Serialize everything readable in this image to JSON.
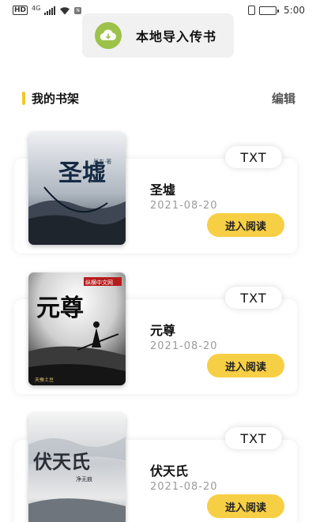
{
  "status_bar": {
    "hd": "HD",
    "network": "4G",
    "badge": "N",
    "time": "5:00",
    "battery_level": 0.85
  },
  "import": {
    "label": "本地导入传书",
    "icon": "cloud-download-icon",
    "icon_color": "#9cc24a"
  },
  "section": {
    "title": "我的书架",
    "edit_label": "编辑",
    "accent_color": "#f2c62b"
  },
  "books": [
    {
      "title": "圣墟",
      "date": "2021-08-20",
      "format": "TXT",
      "read_label": "进入阅读",
      "cover_title": "圣墟",
      "cover_author": "辰东·著"
    },
    {
      "title": "元尊",
      "date": "2021-08-20",
      "format": "TXT",
      "read_label": "进入阅读",
      "cover_title": "元尊",
      "cover_publisher": "纵横中文网",
      "cover_author": "天蚕土豆"
    },
    {
      "title": "伏天氏",
      "date": "2021-08-20",
      "format": "TXT",
      "read_label": "进入阅读",
      "cover_title": "伏天氏",
      "cover_author": "净无痕"
    }
  ],
  "colors": {
    "read_button": "#f7cf45",
    "date_text": "#9a9a9a"
  }
}
